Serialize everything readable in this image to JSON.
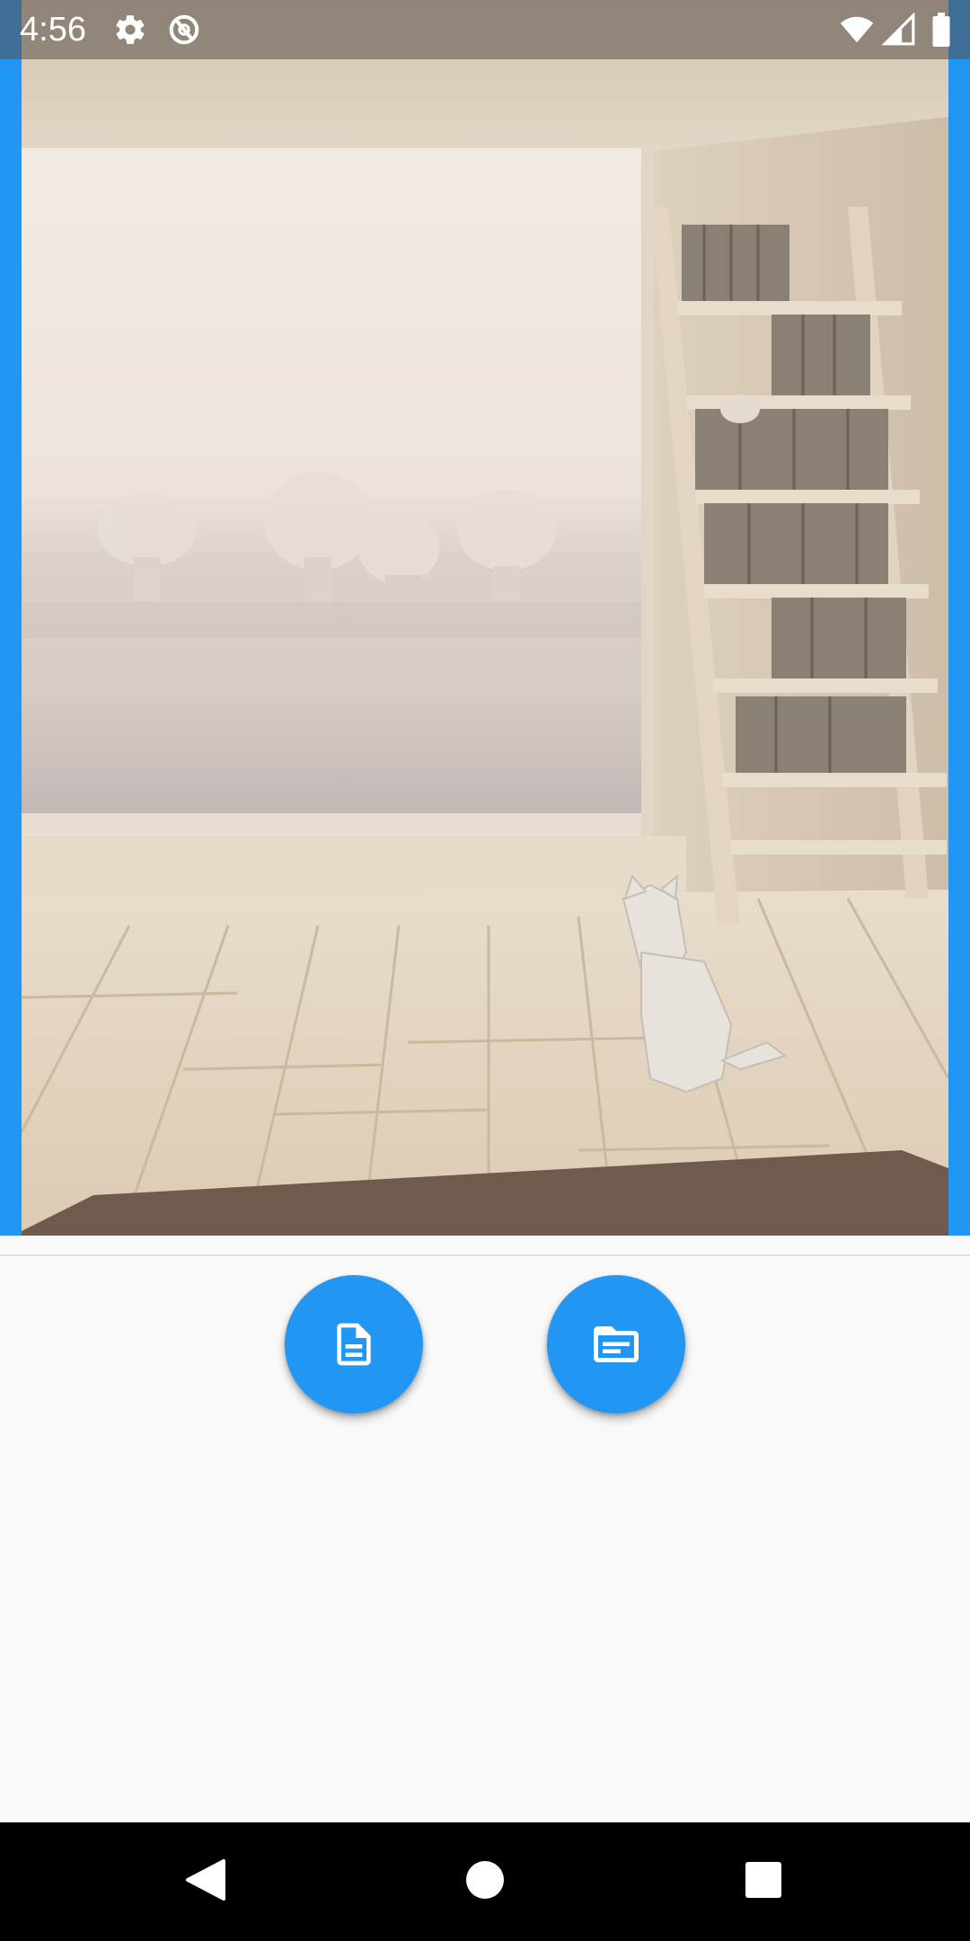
{
  "status_bar": {
    "time": "4:56",
    "icons": [
      "settings-icon",
      "data-saver-icon",
      "wifi-icon",
      "cellular-signal-icon",
      "battery-icon"
    ]
  },
  "image": {
    "subject": "room-with-cat-and-bookshelf",
    "frame_color": "#2196F3"
  },
  "actions": {
    "fab_color": "#2196F3",
    "buttons": [
      {
        "icon": "document-icon"
      },
      {
        "icon": "folder-icon"
      }
    ]
  },
  "nav": {
    "buttons": [
      "back-icon",
      "home-icon",
      "recents-icon"
    ]
  }
}
